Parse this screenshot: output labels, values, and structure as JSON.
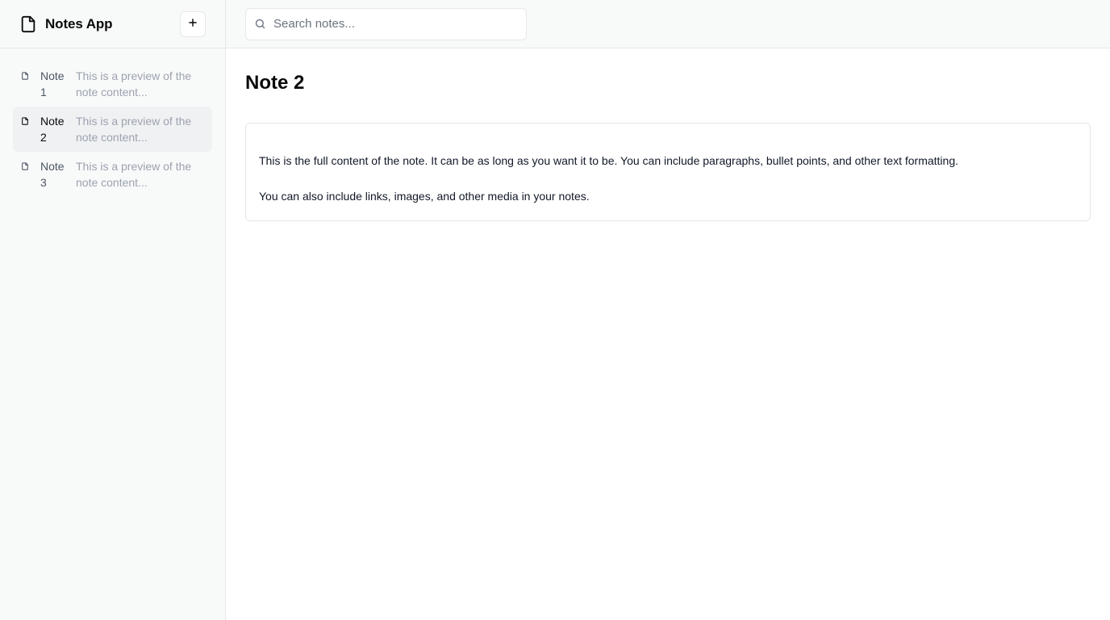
{
  "app": {
    "title": "Notes App",
    "new_note_label": "+"
  },
  "search": {
    "placeholder": "Search notes...",
    "value": ""
  },
  "notes": [
    {
      "title": "Note 1",
      "title_line1": "Note",
      "title_line2": "1",
      "preview": "This is a preview of the note content...",
      "active": false
    },
    {
      "title": "Note 2",
      "title_line1": "Note",
      "title_line2": "2",
      "preview": "This is a preview of the note content...",
      "active": true
    },
    {
      "title": "Note 3",
      "title_line1": "Note",
      "title_line2": "3",
      "preview": "This is a preview of the note content...",
      "active": false
    }
  ],
  "current_note": {
    "title": "Note 2",
    "paragraphs": [
      "This is the full content of the note. It can be as long as you want it to be. You can include paragraphs, bullet points, and other text formatting.",
      "You can also include links, images, and other media in your notes."
    ]
  },
  "icons": {
    "brand": "file-icon",
    "note": "file-icon",
    "search": "search-icon"
  },
  "colors": {
    "sidebar_bg": "#f8f9f9",
    "active_item_bg": "#f0f1f3",
    "border": "#e5e7eb",
    "muted_text": "#9ca3af"
  }
}
